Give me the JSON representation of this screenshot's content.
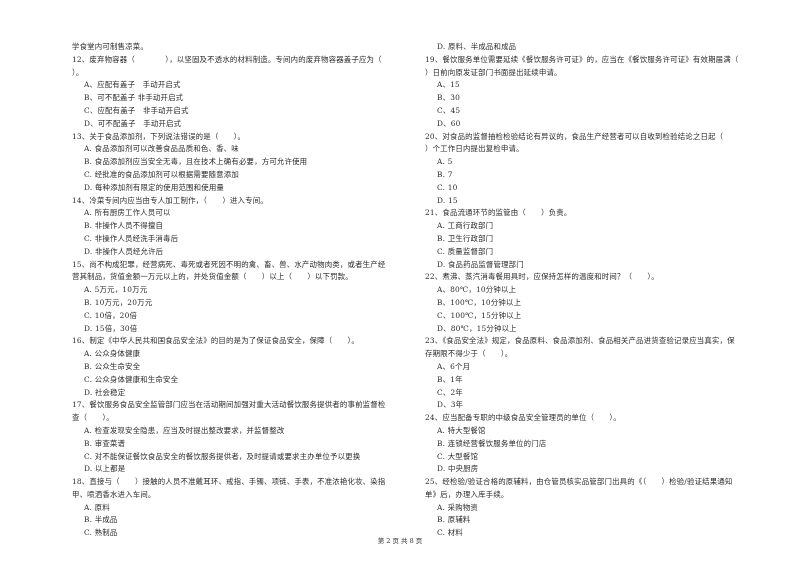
{
  "document": {
    "left_column": [
      {
        "type": "text",
        "text": "学食堂内可制售凉菜。"
      },
      {
        "type": "text",
        "text": "12、废弃物容器（　　　　），以坚固及不透水的材料制造。专间内的废弃物容器盖子应为（"
      },
      {
        "type": "text",
        "text": "）。"
      },
      {
        "type": "option",
        "text": "A、应配有盖子　手动开启式"
      },
      {
        "type": "option",
        "text": "B、可不配盖子 非手动开启式"
      },
      {
        "type": "option",
        "text": "C、应配有盖子　非手动开启式"
      },
      {
        "type": "option",
        "text": "D、可不配盖子　手动开启式"
      },
      {
        "type": "text",
        "text": "13、关于食品添加剂，下列说法错误的是（　　）。"
      },
      {
        "type": "option",
        "text": "A. 食品添加剂可以改善食品品质和色、香、味"
      },
      {
        "type": "option",
        "text": "B. 食品添加剂应当安全无毒，且在技术上确有必要，方可允许使用"
      },
      {
        "type": "option",
        "text": "C. 经批准的食品添加剂可以根据需要随意添加"
      },
      {
        "type": "option",
        "text": "D. 每种添加剂有限定的使用范围和使用量"
      },
      {
        "type": "text",
        "text": "14、冷菜专间内应当由专人加工制作，（　　）进入专间。"
      },
      {
        "type": "option",
        "text": "A. 所有厨房工作人员可以"
      },
      {
        "type": "option",
        "text": "B. 非操作人员不得擅自"
      },
      {
        "type": "option",
        "text": "C. 非操作人员经洗手消毒后"
      },
      {
        "type": "option",
        "text": "D. 非操作人员经允许后"
      },
      {
        "type": "text",
        "text": "15、尚不构成犯罪，经营病死、毒死或者死因不明的禽、畜、兽、水产动物肉类，或者生产经"
      },
      {
        "type": "text",
        "text": "营其制品，货值金额一万元以上的，并处货值金额（　　）以上（　　）以下罚款。"
      },
      {
        "type": "option",
        "text": "A. 5万元，10万元"
      },
      {
        "type": "option",
        "text": "B. 10万元，20万元"
      },
      {
        "type": "option",
        "text": "C. 10倍，20倍"
      },
      {
        "type": "option",
        "text": "D. 15倍，30倍"
      },
      {
        "type": "text",
        "text": "16、制定《中华人民共和国食品安全法》的目的是为了保证食品安全，保障（　　）。"
      },
      {
        "type": "option",
        "text": "A. 公众身体健康"
      },
      {
        "type": "option",
        "text": "B. 公众生命安全"
      },
      {
        "type": "option",
        "text": "C. 公众身体健康和生命安全"
      },
      {
        "type": "option",
        "text": "D. 社会稳定"
      },
      {
        "type": "text",
        "text": "17、餐饮服务食品安全监管部门应当在活动期间加强对重大活动餐饮服务提供者的事前监督检"
      },
      {
        "type": "text",
        "text": "查（　　）。"
      },
      {
        "type": "option",
        "text": "A. 检查发现安全隐患，应当及时提出整改要求，并监督整改"
      },
      {
        "type": "option",
        "text": "B. 审查菜谱"
      },
      {
        "type": "option",
        "text": "C. 对不能保证餐饮食品安全的餐饮服务提供者，及时提请或要求主办单位予以更换"
      },
      {
        "type": "option",
        "text": "D. 以上都是"
      },
      {
        "type": "text",
        "text": "18、直接与（　　）接触的人员不准戴耳环、戒指、手镯、项链、手表，不准浓艳化妆、染指"
      },
      {
        "type": "text",
        "text": "甲、喷洒香水进入车间。"
      },
      {
        "type": "option",
        "text": "A. 原料"
      },
      {
        "type": "option",
        "text": "B. 半成品"
      },
      {
        "type": "option",
        "text": "C. 熟制品"
      }
    ],
    "right_column": [
      {
        "type": "option",
        "text": "D. 原料、半成品和成品"
      },
      {
        "type": "text",
        "text": "19、餐饮服务单位需要延续《餐饮服务许可证》的，应当在《餐饮服务许可证》有效期届满（"
      },
      {
        "type": "text",
        "text": "）日前向原发证部门书面提出延续申请。"
      },
      {
        "type": "option",
        "text": "A、15"
      },
      {
        "type": "option",
        "text": "B、30"
      },
      {
        "type": "option",
        "text": "C、45"
      },
      {
        "type": "option",
        "text": "D、60"
      },
      {
        "type": "text",
        "text": "20、对食品的监督抽检检验结论有异议的，食品生产经营者可以自收到检验结论之日起（"
      },
      {
        "type": "text",
        "text": "）个工作日内提出复检申请。"
      },
      {
        "type": "option",
        "text": "A. 5"
      },
      {
        "type": "option",
        "text": "B. 7"
      },
      {
        "type": "option",
        "text": "C. 10"
      },
      {
        "type": "option",
        "text": "D. 15"
      },
      {
        "type": "text",
        "text": "21、食品流通环节的监管由（　　）负责。"
      },
      {
        "type": "option",
        "text": "A. 工商行政部门"
      },
      {
        "type": "option",
        "text": "B. 卫生行政部门"
      },
      {
        "type": "option",
        "text": "C. 质量监督部门"
      },
      {
        "type": "option",
        "text": "D. 食品药品监督管理部门"
      },
      {
        "type": "text",
        "text": "22、煮沸、蒸汽消毒餐用具时，应保持怎样的温度和时间？（　　）。"
      },
      {
        "type": "option",
        "text": "A、80℃，10分钟以上"
      },
      {
        "type": "option",
        "text": "B、100℃，10分钟以上"
      },
      {
        "type": "option",
        "text": "C、100℃，15分钟以上"
      },
      {
        "type": "option",
        "text": "D、80℃，15分钟以上"
      },
      {
        "type": "text",
        "text": "23、《食品安全法》规定，食品原料、食品添加剂、食品相关产品进货查验记录应当真实，保"
      },
      {
        "type": "text",
        "text": "存期限不得少于（　　）。"
      },
      {
        "type": "option",
        "text": "A、6个月"
      },
      {
        "type": "option",
        "text": "B、1年"
      },
      {
        "type": "option",
        "text": "C、2年"
      },
      {
        "type": "option",
        "text": "D、3年"
      },
      {
        "type": "text",
        "text": "24、应当配备专职的中级食品安全管理员的单位（　　）。"
      },
      {
        "type": "option",
        "text": "A. 特大型餐馆"
      },
      {
        "type": "option",
        "text": "B. 连锁经营餐饮服务单位的门店"
      },
      {
        "type": "option",
        "text": "C. 大型餐馆"
      },
      {
        "type": "option",
        "text": "D. 中央厨房"
      },
      {
        "type": "text",
        "text": "25、经检验/验证合格的原辅料，由仓管员核实品管部门出具的《（　　）检验/验证结果通知"
      },
      {
        "type": "text",
        "text": "单》后，办理入库手续。"
      },
      {
        "type": "option",
        "text": "A. 采购物资"
      },
      {
        "type": "option",
        "text": "B. 原辅料"
      },
      {
        "type": "option",
        "text": "C. 材料"
      }
    ],
    "footer": "第 2 页 共 8 页"
  }
}
